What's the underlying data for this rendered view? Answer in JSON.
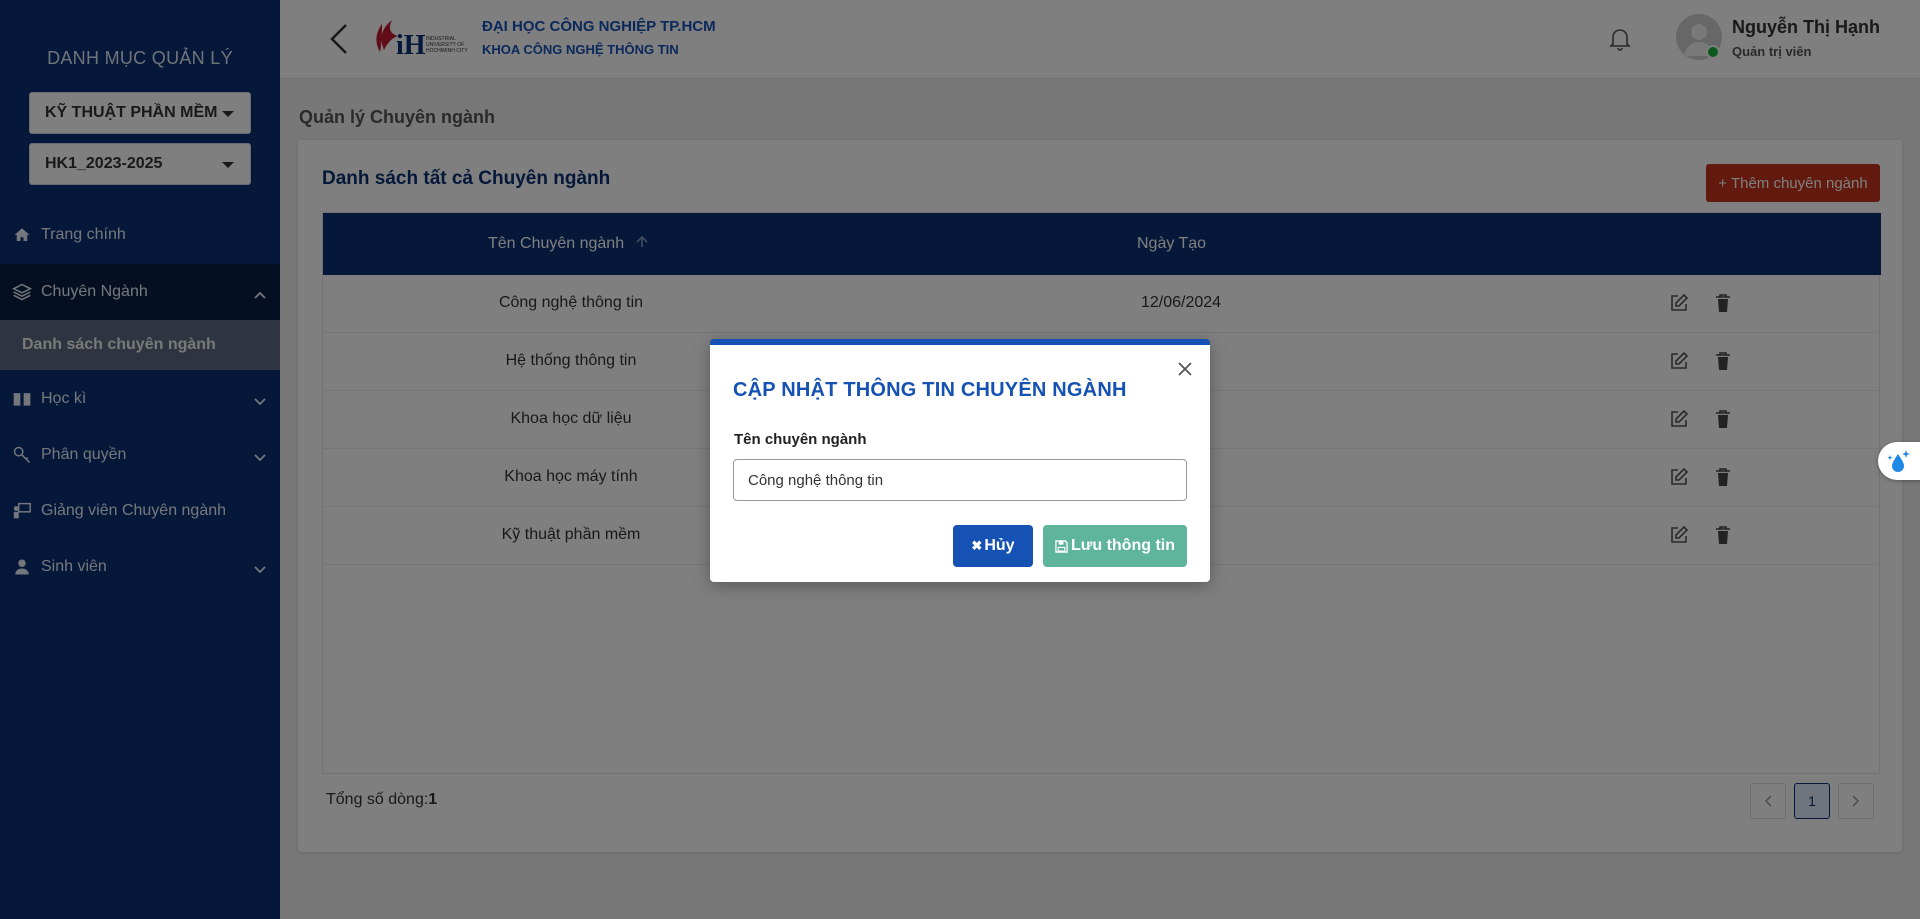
{
  "sidebar": {
    "title": "DANH MỤC QUẢN LÝ",
    "department_select": "KỸ THUẬT PHẦN MỀM",
    "semester_select": "HK1_2023-2025",
    "items": [
      {
        "label": "Trang chính",
        "icon": "home-icon"
      },
      {
        "label": "Chuyên Ngành",
        "icon": "layers-icon",
        "expanded": true
      },
      {
        "label": "Danh sách chuyên ngành",
        "sub": true
      },
      {
        "label": "Học kì",
        "icon": "book-icon"
      },
      {
        "label": "Phân quyền",
        "icon": "key-icon"
      },
      {
        "label": "Giảng viên Chuyên ngành",
        "icon": "teacher-icon"
      },
      {
        "label": "Sinh viên",
        "icon": "user-icon"
      }
    ]
  },
  "header": {
    "uni_name": "ĐẠI HỌC CÔNG NGHIỆP TP.HCM",
    "faculty": "KHOA CÔNG NGHỆ THÔNG TIN",
    "user_name": "Nguyễn Thị Hạnh",
    "user_role": "Quản trị viên"
  },
  "main": {
    "page_title": "Quản lý Chuyên ngành",
    "card_title": "Danh sách tất cả Chuyên ngành",
    "add_button": "+ Thêm chuyên ngành",
    "columns": [
      "Tên Chuyên ngành",
      "Ngày Tạo"
    ],
    "rows": [
      {
        "name": "Công nghệ thông tin",
        "date": "12/06/2024"
      },
      {
        "name": "Hệ thống thông tin",
        "date": ""
      },
      {
        "name": "Khoa học dữ liệu",
        "date": ""
      },
      {
        "name": "Khoa học máy tính",
        "date": ""
      },
      {
        "name": "Kỹ thuật phần mềm",
        "date": ""
      }
    ],
    "total_label": "Tổng số dòng:",
    "total_value": "1",
    "current_page": "1"
  },
  "modal": {
    "title": "CẬP NHẬT THÔNG TIN CHUYÊN NGÀNH",
    "field_label": "Tên chuyên ngành",
    "field_value": "Công nghệ thông tin",
    "cancel_label": "Hủy",
    "save_label": "Lưu thông tin"
  },
  "colors": {
    "sidebar": "#0a3174",
    "primary": "#1552b4",
    "danger": "#c2351b",
    "success": "#5fb49c"
  }
}
